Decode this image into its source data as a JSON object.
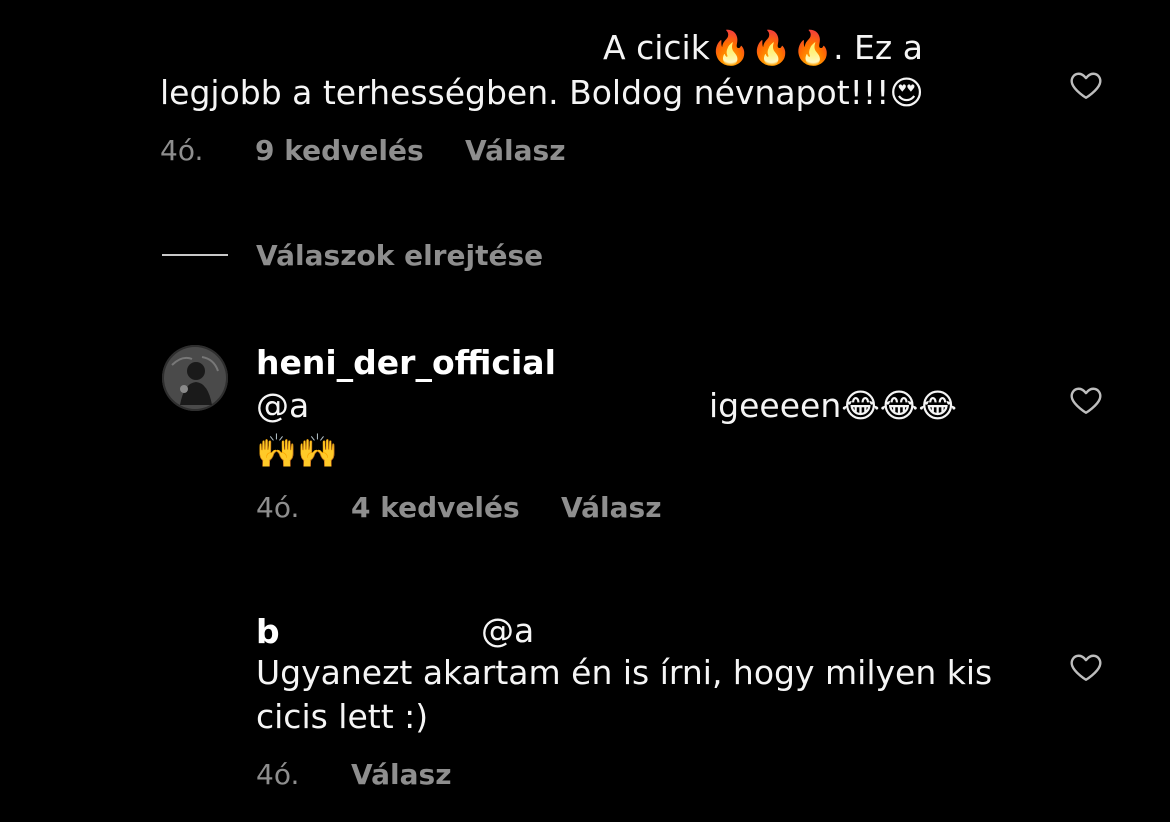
{
  "comment1": {
    "line1": "A cicik🔥🔥🔥. Ez a",
    "line2": "legjobb a terhességben. Boldog névnapot!!!😍",
    "time": "4ó.",
    "likes": "9 kedvelés",
    "reply_label": "Válasz"
  },
  "replies_toggle": {
    "label": "Válaszok elrejtése"
  },
  "reply1": {
    "username": "heni_der_official",
    "mention": "@a",
    "text_end": "igeeeen😂😂😂",
    "line2": "🙌🙌",
    "time": "4ó.",
    "likes": "4 kedvelés",
    "reply_label": "Válasz"
  },
  "reply2": {
    "username": "b",
    "mention": "@a",
    "line1": "Ugyanezt akartam én is írni, hogy milyen kis",
    "line2": "cicis lett :)",
    "time": "4ó.",
    "reply_label": "Válasz"
  },
  "icons": {
    "like": "heart-outline-icon",
    "avatar": "profile-avatar"
  },
  "colors": {
    "background": "#000000",
    "text": "#f5f5f5",
    "meta": "#8e8e8e"
  }
}
